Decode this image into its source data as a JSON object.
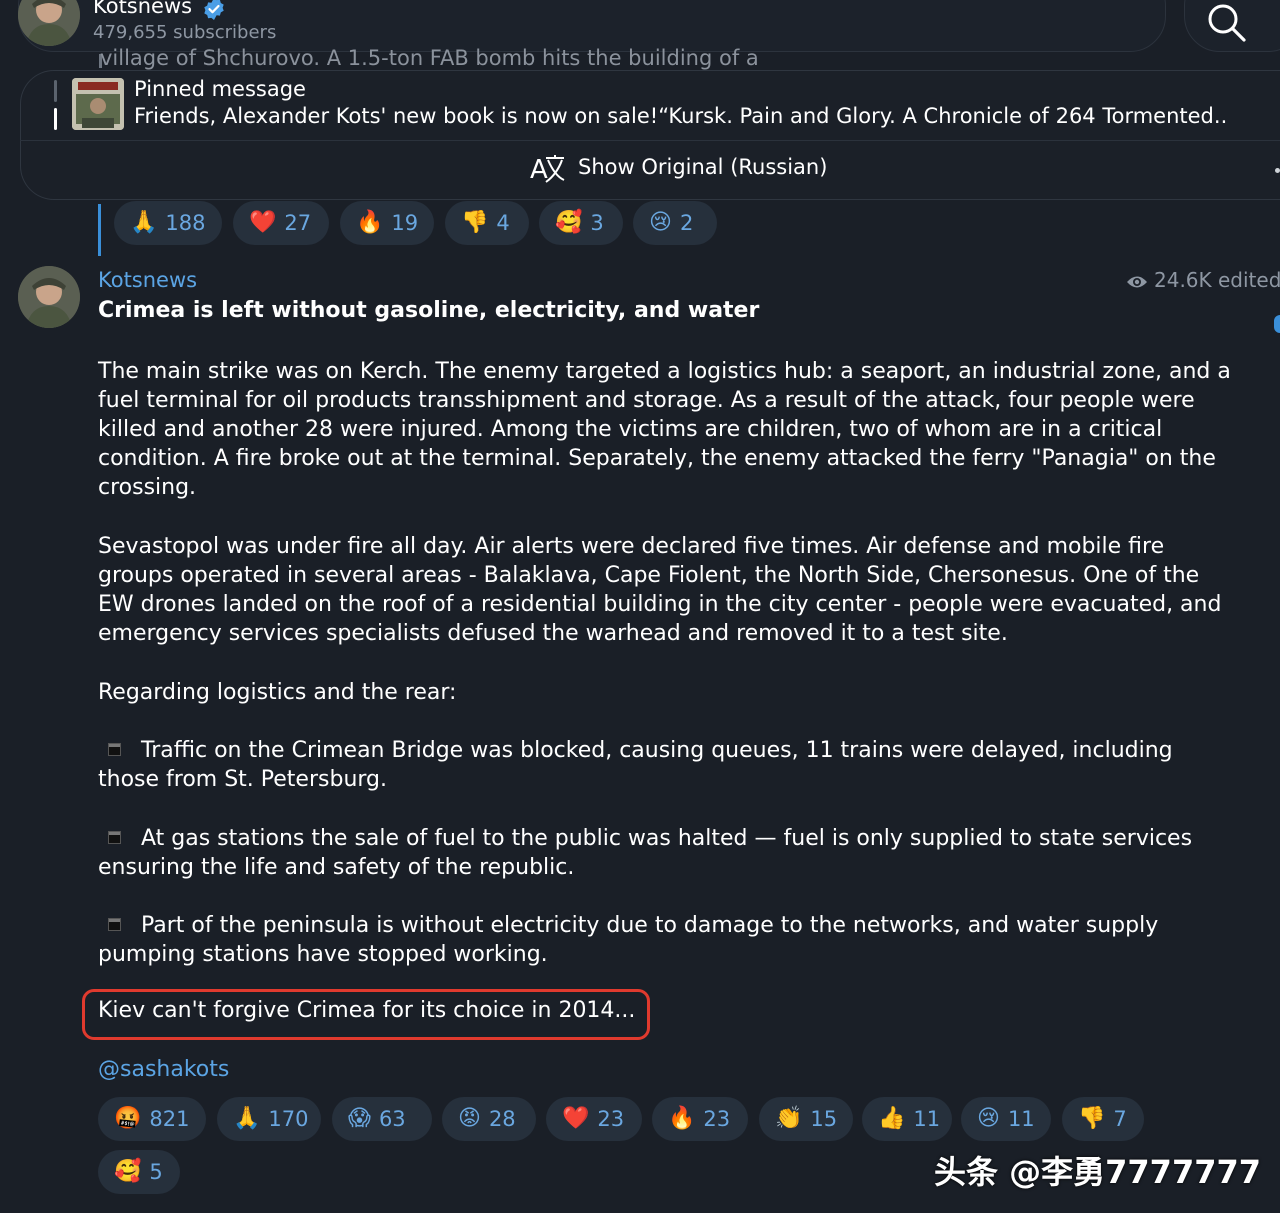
{
  "header": {
    "channel_name": "Kotsnews",
    "subscribers": "479,655 subscribers"
  },
  "scroll_peek_text": "village of Shchurovo. A 1.5-ton FAB bomb hits the building of a",
  "pinned": {
    "title": "Pinned message",
    "text": "Friends, Alexander Kots' new book is now on sale!“Kursk. Pain and Glory. A Chronicle of 264 Tormented..."
  },
  "translate": {
    "label": "Show Original (Russian)"
  },
  "prev_reactions": [
    {
      "emoji": "🙏",
      "count": "188"
    },
    {
      "emoji": "❤️",
      "count": "27"
    },
    {
      "emoji": "🔥",
      "count": "19"
    },
    {
      "emoji": "👎",
      "count": "4"
    },
    {
      "emoji": "🥰",
      "count": "3"
    },
    {
      "emoji": "😢",
      "count": "2"
    }
  ],
  "message": {
    "author": "Kotsnews",
    "views": "24.6K edited",
    "title": "Crimea is left without gasoline, electricity, and water",
    "paragraphs": [
      "The main strike was on Kerch. The enemy targeted a logistics hub: a seaport, an industrial zone, and a fuel terminal for oil products transshipment and storage. As a result of the attack, four people were killed and another 28 were injured. Among the victims are children, two of whom are in a critical condition. A fire broke out at the terminal. Separately, the enemy attacked the ferry \"Panagia\" on the crossing.",
      "Sevastopol was under fire all day. Air alerts were declared five times. Air defense and mobile fire groups operated in several areas - Balaklava, Cape Fiolent, the North Side, Chersonesus. One of the EW drones landed on the roof of a residential building in the city center - people were evacuated, and emergency services specialists defused the warhead and removed it to a test site.",
      "Regarding logistics and the rear:"
    ],
    "bullets": [
      "Traffic on the Crimean Bridge was blocked, causing queues, 11 trains were delayed, including those from St. Petersburg.",
      "At gas stations the sale of fuel to the public was halted — fuel is only supplied to state services ensuring the life and safety of the republic.",
      "Part of the peninsula is without electricity due to damage to the networks, and water supply pumping stations have stopped working."
    ],
    "highlight": "Kiev can't forgive Crimea for its choice in 2014...",
    "mention": "@sashakots"
  },
  "reactions": [
    {
      "emoji": "🤬",
      "count": "821"
    },
    {
      "emoji": "🙏",
      "count": "170"
    },
    {
      "emoji": "😱",
      "count": "63"
    },
    {
      "emoji": "😡",
      "count": "28"
    },
    {
      "emoji": "❤️",
      "count": "23"
    },
    {
      "emoji": "🔥",
      "count": "23"
    },
    {
      "emoji": "👏",
      "count": "15"
    },
    {
      "emoji": "👍",
      "count": "11"
    },
    {
      "emoji": "😢",
      "count": "11"
    },
    {
      "emoji": "👎",
      "count": "7"
    },
    {
      "emoji": "🥰",
      "count": "5"
    }
  ],
  "watermark": "头条 @李勇7777777",
  "colors": {
    "background": "#1a1f27",
    "accent": "#5ba4e4",
    "reaction_bg": "#26303c",
    "highlight_border": "#e03a2e"
  }
}
